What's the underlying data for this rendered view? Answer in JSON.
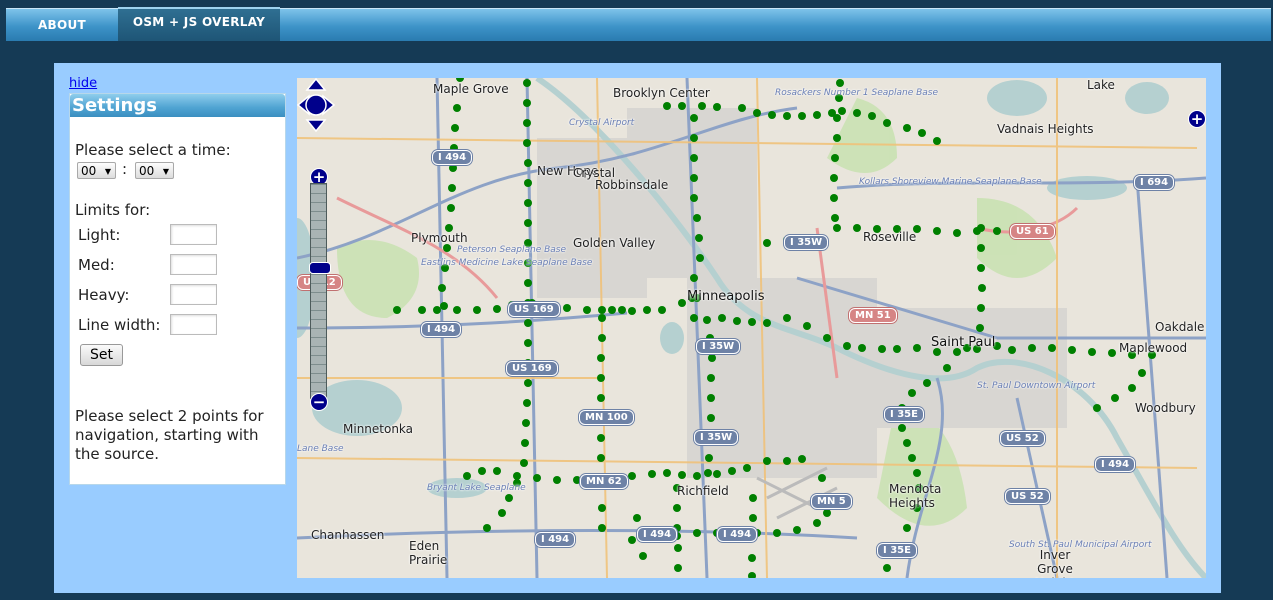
{
  "nav": {
    "tabs": [
      {
        "label": "ABOUT"
      },
      {
        "label": "OSM + JS OVERLAY"
      }
    ]
  },
  "sidebar": {
    "hide_label": "hide",
    "title": "Settings",
    "time_prompt": "Please select a time:",
    "hour_value": "00",
    "minute_value": "00",
    "time_separator": ":",
    "limits_title": "Limits for:",
    "light_label": "Light:",
    "med_label": "Med:",
    "heavy_label": "Heavy:",
    "line_width_label": "Line width:",
    "set_label": "Set",
    "nav_instructions": "Please select 2 points for navigation, starting with the source."
  },
  "map": {
    "city_labels": [
      {
        "text": "Minneapolis"
      },
      {
        "text": "Saint Paul"
      },
      {
        "text": "Maple Grove"
      },
      {
        "text": "Brooklyn Center"
      },
      {
        "text": "New Hope"
      },
      {
        "text": "Crystal"
      },
      {
        "text": "Robbinsdale"
      },
      {
        "text": "Plymouth"
      },
      {
        "text": "Golden Valley"
      },
      {
        "text": "Roseville"
      },
      {
        "text": "Vadnais Heights"
      },
      {
        "text": "Lake"
      },
      {
        "text": "Oakdale"
      },
      {
        "text": "Maplewood"
      },
      {
        "text": "Woodbury"
      },
      {
        "text": "Minnetonka"
      },
      {
        "text": "Richfield"
      },
      {
        "text": "Mendota Heights"
      },
      {
        "text": "Eden Prairie"
      },
      {
        "text": "Chanhassen"
      },
      {
        "text": "Inver Grove Heights"
      }
    ],
    "poi_labels": [
      {
        "text": "Crystal Airport"
      },
      {
        "text": "Rosackers Number 1 Seaplane Base"
      },
      {
        "text": "Kollars Shoreview Marine Seaplane Base"
      },
      {
        "text": "Peterson Seaplane Base"
      },
      {
        "text": "Eastlins Medicine Lake Seaplane Base"
      },
      {
        "text": "St. Paul Downtown Airport"
      },
      {
        "text": "Bryant Lake Seaplane"
      },
      {
        "text": "South St. Paul Municipal Airport"
      },
      {
        "text": "Lane Base"
      }
    ],
    "shields": [
      {
        "text": "I 494"
      },
      {
        "text": "I 694"
      },
      {
        "text": "US 61"
      },
      {
        "text": "US 169"
      },
      {
        "text": "I 35W"
      },
      {
        "text": "MN 51"
      },
      {
        "text": "I 494"
      },
      {
        "text": "US 169"
      },
      {
        "text": "I 35W"
      },
      {
        "text": "MN 100"
      },
      {
        "text": "I 35W"
      },
      {
        "text": "I 35E"
      },
      {
        "text": "US 52"
      },
      {
        "text": "I 494"
      },
      {
        "text": "US 52"
      },
      {
        "text": "I 494"
      },
      {
        "text": "MN 5"
      },
      {
        "text": "I 35E"
      },
      {
        "text": "US 12"
      },
      {
        "text": "MN 62"
      },
      {
        "text": "I 494"
      },
      {
        "text": "I 494"
      }
    ],
    "route_color": "#008000"
  }
}
